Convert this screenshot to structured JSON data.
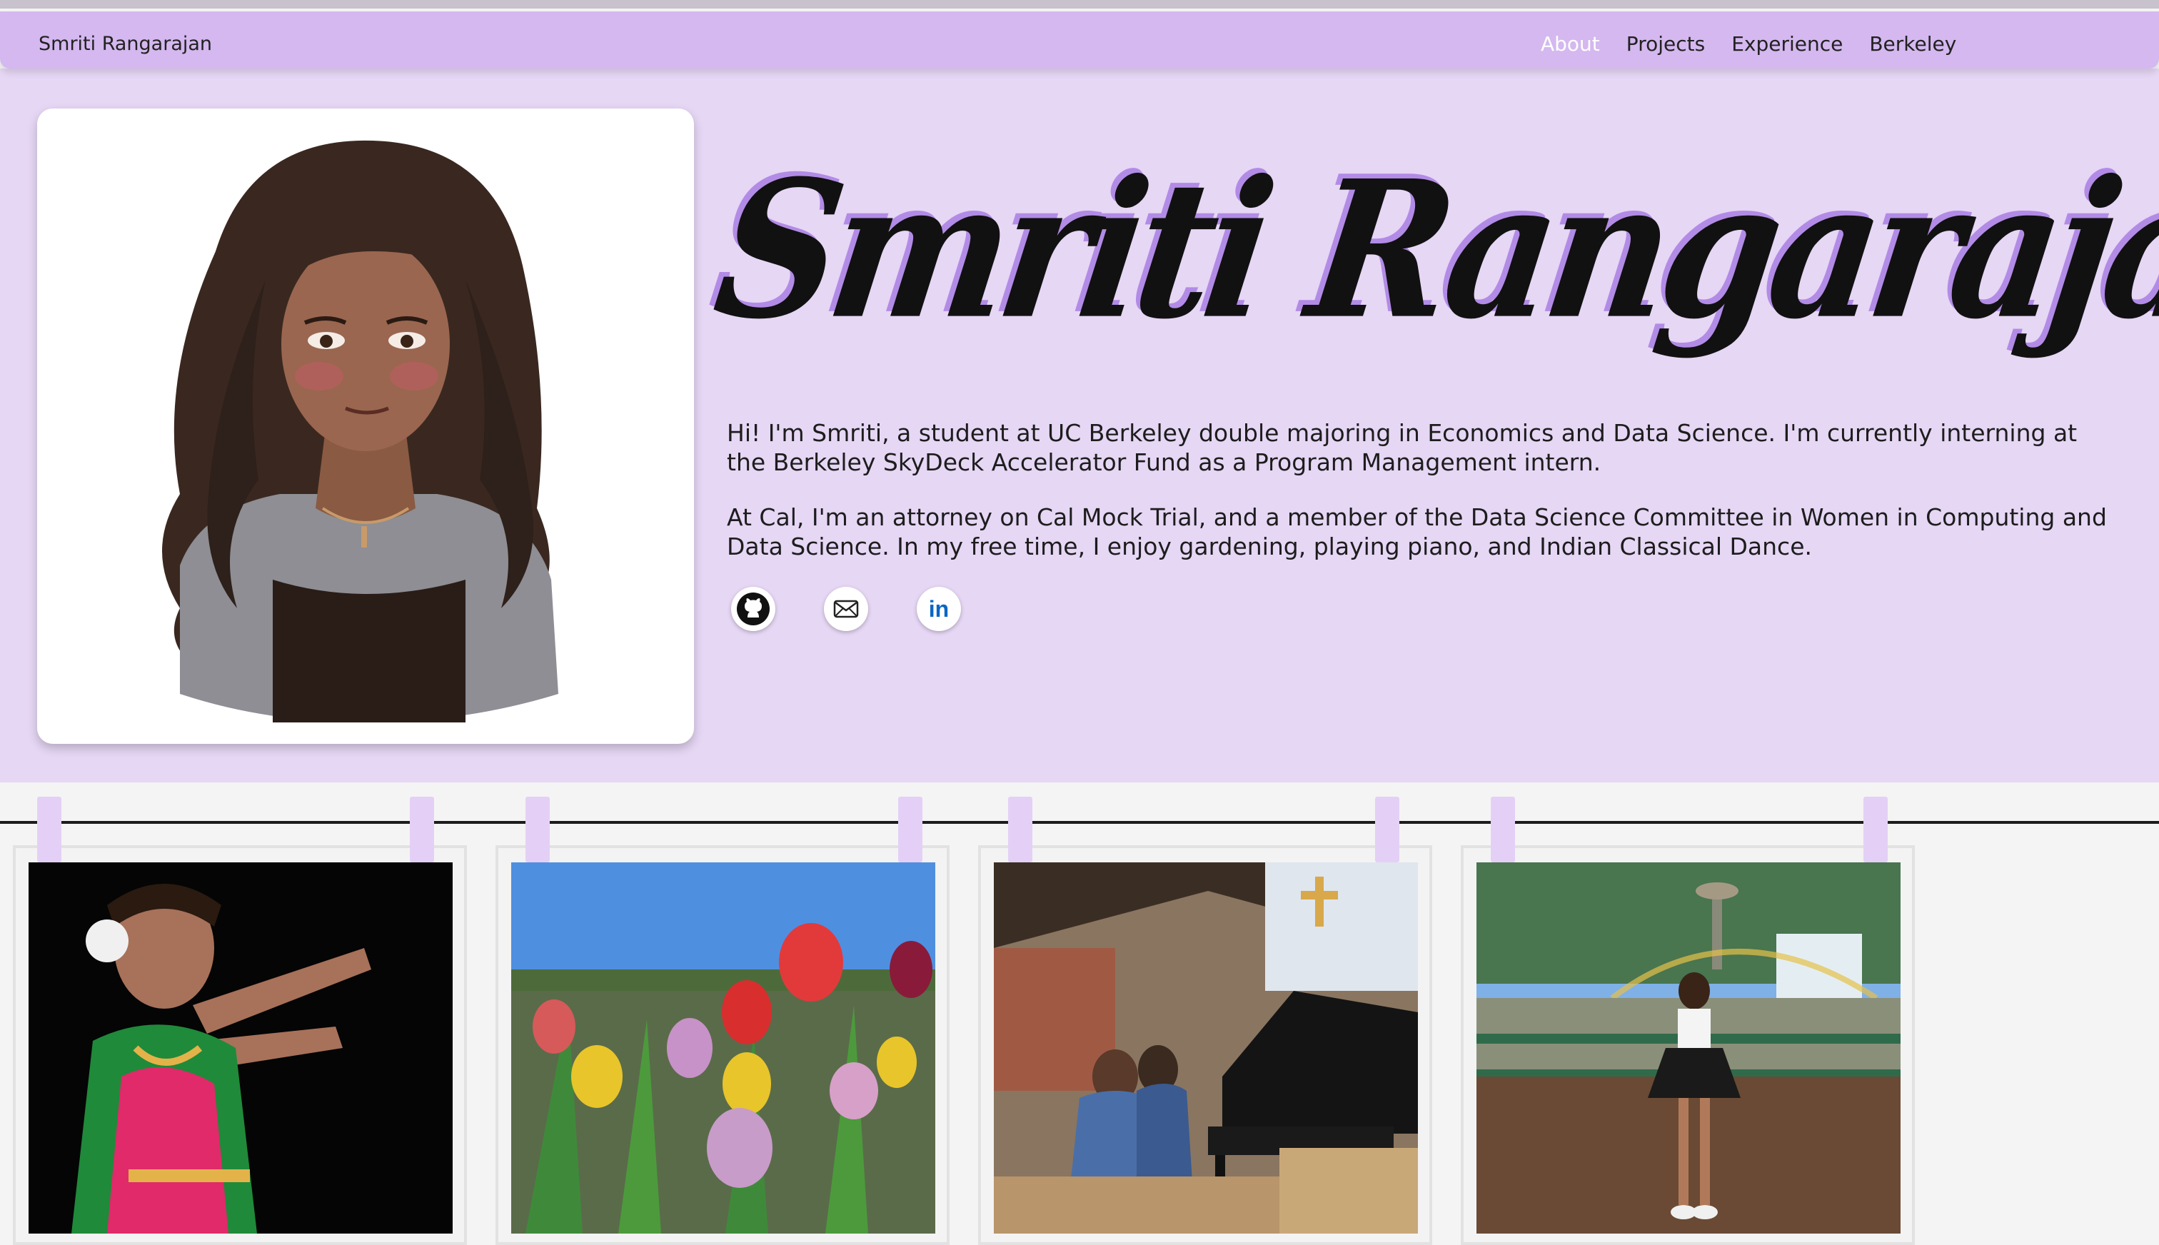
{
  "nav": {
    "brand": "Smriti Rangarajan",
    "links": [
      "About",
      "Projects",
      "Experience",
      "Berkeley"
    ],
    "active": "About"
  },
  "hero": {
    "title": "Smriti Rangarajan",
    "bio": [
      "Hi! I'm Smriti, a student at UC Berkeley double majoring in Economics and Data Science. I'm currently interning at the Berkeley SkyDeck Accelerator Fund as a Program Management intern.",
      "At Cal, I'm an attorney on Cal Mock Trial, and a member of the Data Science Committee in Women in Computing and Data Science. In my free time, I enjoy gardening, playing piano, and Indian Classical Dance."
    ],
    "portrait": "illustrated-portrait",
    "socials": [
      {
        "icon": "github-icon"
      },
      {
        "icon": "mail-icon"
      },
      {
        "icon": "linkedin-icon",
        "label": "in"
      }
    ]
  },
  "gallery": {
    "photos": [
      "classical-dance-photo",
      "tulips-photo",
      "piano-duet-photo",
      "waterfall-photo"
    ]
  },
  "colors": {
    "nav_bg": "#d4b8ef",
    "hero_bg": "#e6d7f5",
    "title_shadow": "#b28be6",
    "active_link": "#ffffff",
    "clip": "#e4d0f6",
    "linkedin": "#0a66c2"
  }
}
